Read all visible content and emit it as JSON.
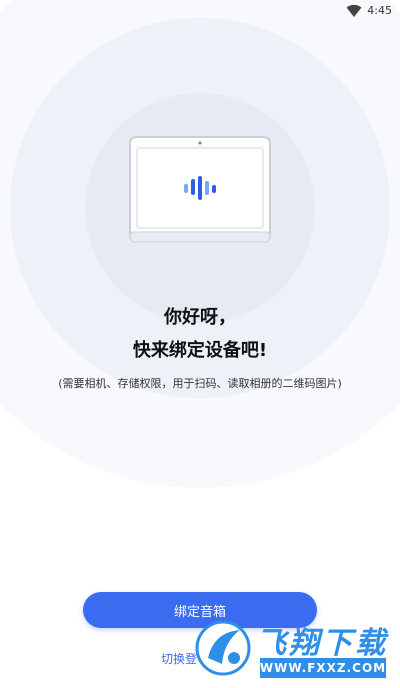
{
  "status_bar": {
    "time": "4:45",
    "wifi_icon": "wifi-icon"
  },
  "illustration": {
    "icon": "smart-display-icon",
    "colors": {
      "bar_dark": "#2d5fe0",
      "bar_light": "#7aa7f5"
    }
  },
  "greeting": {
    "line1": "你好呀，",
    "line2": "快来绑定设备吧!"
  },
  "permission_note": "(需要相机、存储权限，用于扫码、读取相册的二维码图片)",
  "bind_button": {
    "label": "绑定音箱",
    "color": "#3a6cf0"
  },
  "switch_link": {
    "label": "切换登"
  },
  "watermark": {
    "name": "飞翔下载",
    "url": "WWW.FXXZ.COM",
    "color": "#2f8fe8"
  }
}
